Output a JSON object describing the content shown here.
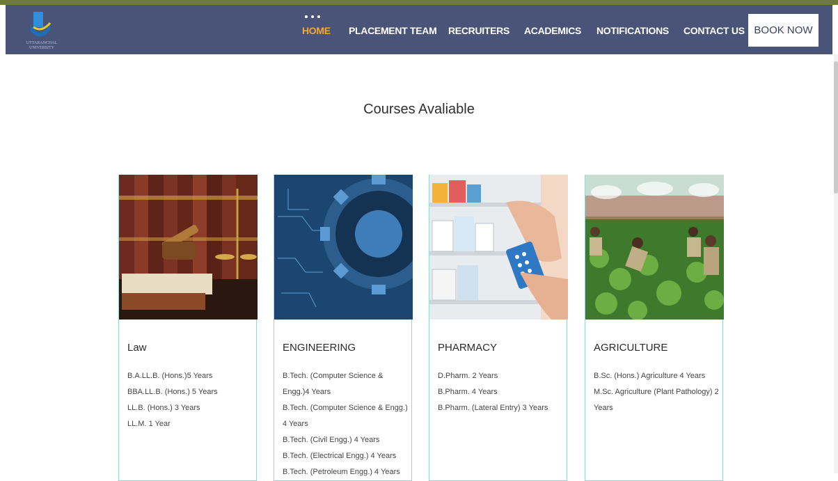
{
  "nav": {
    "items": [
      {
        "label": "HOME",
        "active": true
      },
      {
        "label": "PLACEMENT TEAM"
      },
      {
        "label": "RECRUITERS"
      },
      {
        "label": "ACADEMICS"
      },
      {
        "label": "NOTIFICATIONS"
      },
      {
        "label": "CONTACT US"
      }
    ],
    "book_label": "BOOK NOW",
    "logo_text": "UTTARANCHAL UNIVERSITY"
  },
  "section": {
    "title": "Courses Avaliable"
  },
  "cards": [
    {
      "title": "Law",
      "image": "law-books-gavel-image",
      "courses": [
        "B.A.LL.B. (Hons.)5 Years",
        "BBA.LL.B. (Hons.) 5 Years",
        "LL.B. (Hons.) 3 Years",
        "LL.M. 1 Year"
      ]
    },
    {
      "title": "ENGINEERING",
      "image": "engineering-gear-circuit-image",
      "courses": [
        "B.Tech. (Computer Science & Engg.)4 Years",
        "B.Tech. (Computer Science & Engg.) 4 Years",
        "B.Tech. (Civil Engg.) 4 Years",
        "B.Tech. (Electrical Engg.) 4 Years",
        "B.Tech. (Petroleum Engg.) 4 Years"
      ]
    },
    {
      "title": "PHARMACY",
      "image": "pharmacy-shelves-medicine-image",
      "courses": [
        "D.Pharm. 2 Years",
        "B.Pharm. 4 Years",
        "B.Pharm. (Lateral Entry) 3 Years"
      ]
    },
    {
      "title": "AGRICULTURE",
      "image": "agriculture-field-students-image",
      "courses": [
        "B.Sc. (Hons.) Agriculture 4 Years",
        "M.Sc. Agriculture (Plant Pathology) 2 Years"
      ]
    }
  ],
  "colors": {
    "nav_bg": "#4a5478",
    "active": "#f1a936",
    "card_border": "#9fd3d3"
  }
}
